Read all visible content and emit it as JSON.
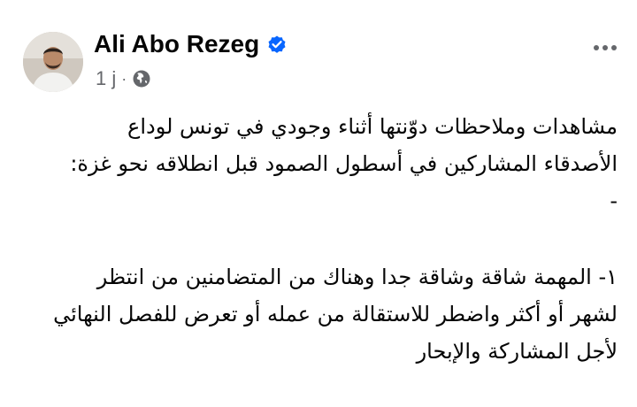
{
  "post": {
    "author": {
      "name": "Ali Abo Rezeg",
      "verified": true,
      "avatar_icon": "profile-photo-man"
    },
    "meta": {
      "time": "1 j",
      "separator": "·",
      "privacy_icon": "globe-icon"
    },
    "more_icon": "more-horizontal-icon",
    "body": {
      "paragraph1": [
        "مشاهدات وملاحظات دوّنتها أثناء وجودي في تونس لوداع",
        "الأصدقاء المشاركين في أسطول الصمود قبل انطلاقه نحو غزة:",
        "-"
      ],
      "paragraph2": [
        "١- المهمة شاقة وشاقة جدا وهناك من المتضامنين من انتظر",
        "لشهر أو أكثر واضطر للاستقالة من عمله أو تعرض للفصل النهائي",
        "لأجل المشاركة والإبحار"
      ]
    }
  },
  "colors": {
    "text": "#050505",
    "secondary": "#65676b",
    "verified_blue": "#0866ff"
  }
}
